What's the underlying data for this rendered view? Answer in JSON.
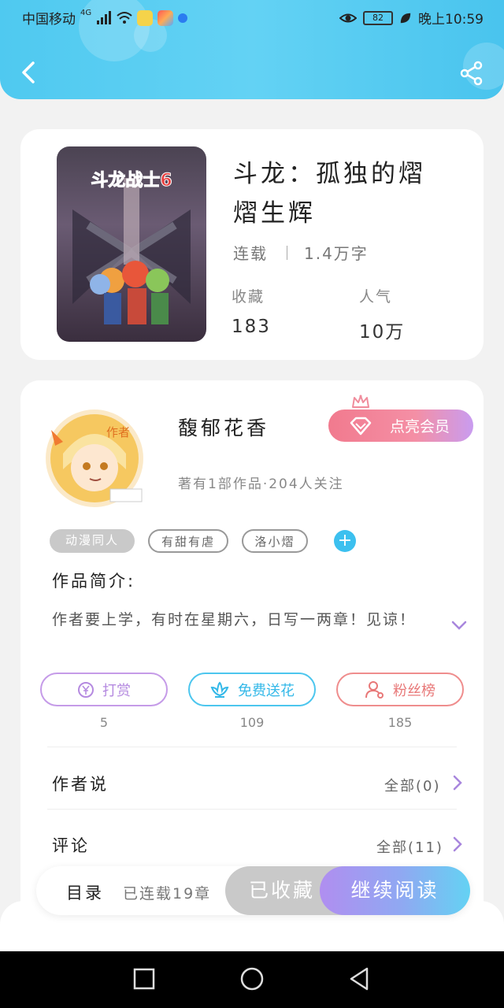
{
  "status_bar": {
    "carrier": "中国移动",
    "net": "4G",
    "battery": "82",
    "time": "晚上10:59"
  },
  "header": {
    "back_icon": "chevron-left-icon",
    "share_icon": "share-icon"
  },
  "book": {
    "title_line1": "斗龙：孤独的熠",
    "title_line2": "熠生辉",
    "status": "连载",
    "word_count": "1.4万字",
    "favorites_label": "收藏",
    "favorites_value": "183",
    "popularity_label": "人气",
    "popularity_value": "10万"
  },
  "author": {
    "avatar_badge": "作者",
    "name": "馥郁花香",
    "info": "著有1部作品·204人关注",
    "vip_label": "点亮会员"
  },
  "tags": [
    "动漫同人",
    "有甜有虐",
    "洛小熠"
  ],
  "intro": {
    "heading": "作品简介:",
    "text": "作者要上学，有时在星期六，日写一两章！见谅！"
  },
  "actions": [
    {
      "label": "打赏",
      "count": "5",
      "icon": "yen-icon",
      "color": "#c59be8"
    },
    {
      "label": "免费送花",
      "count": "109",
      "icon": "flower-icon",
      "color": "#4cc6ee"
    },
    {
      "label": "粉丝榜",
      "count": "185",
      "icon": "user-icon",
      "color": "#ef8d8d"
    }
  ],
  "author_says": {
    "label": "作者说",
    "more": "全部(0)"
  },
  "comments": {
    "label": "评论",
    "more": "全部(11)"
  },
  "bottom_bar": {
    "toc": "目录",
    "chapters": "已连载19章",
    "collected": "已收藏",
    "continue": "继续阅读"
  },
  "colors": {
    "header": "#55cbf2",
    "accent_blue": "#3cc0ef",
    "vip_pink": "#f17a8e",
    "purple": "#b08ef0"
  }
}
